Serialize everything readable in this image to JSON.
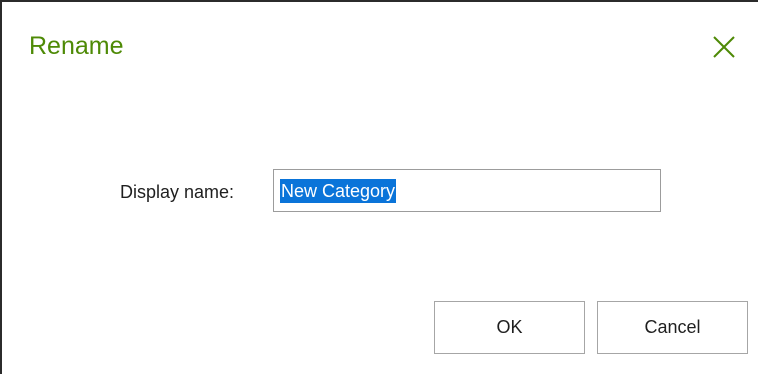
{
  "dialog": {
    "title": "Rename",
    "close_icon": "close-icon",
    "accent_color": "#4e8a06"
  },
  "form": {
    "display_name_label": "Display name:",
    "display_name_value": "New Category",
    "selection_color": "#0a74d9"
  },
  "buttons": {
    "ok_label": "OK",
    "cancel_label": "Cancel"
  }
}
